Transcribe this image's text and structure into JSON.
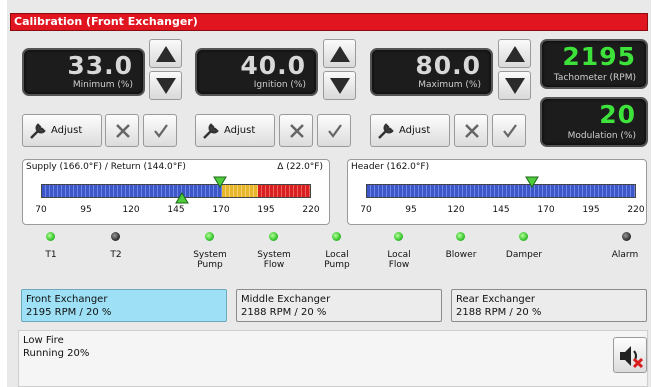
{
  "title": "Calibration (Front Exchanger)",
  "readouts": {
    "minimum": {
      "value": "33.0",
      "label": "Minimum (%)"
    },
    "ignition": {
      "value": "40.0",
      "label": "Ignition (%)"
    },
    "maximum": {
      "value": "80.0",
      "label": "Maximum (%)"
    },
    "tachometer": {
      "value": "2195",
      "label": "Tachometer (RPM)"
    },
    "modulation": {
      "value": "20",
      "label": "Modulation (%)"
    }
  },
  "adjust_label": "Adjust",
  "gauges": {
    "supply": {
      "title": "Supply (166.0°F) / Return (144.0°F)",
      "delta": "Δ (22.0°F)",
      "ticks": [
        "70",
        "95",
        "120",
        "145",
        "170",
        "195",
        "220"
      ],
      "supply_value": 166.0,
      "return_value": 144.0,
      "range": [
        70,
        220
      ],
      "colors": {
        "normal": "#3b57c9",
        "caution": "#e8b62a",
        "alarm": "#d92020"
      }
    },
    "header": {
      "title": "Header (162.0°F)",
      "ticks": [
        "70",
        "95",
        "120",
        "145",
        "170",
        "195",
        "220"
      ],
      "value": 162.0,
      "range": [
        70,
        220
      ]
    }
  },
  "indicators": [
    {
      "label": "T1",
      "state": "on"
    },
    {
      "label": "T2",
      "state": "off"
    },
    {
      "label": "System Pump",
      "state": "on"
    },
    {
      "label": "System Flow",
      "state": "on"
    },
    {
      "label": "Local Pump",
      "state": "on"
    },
    {
      "label": "Local Flow",
      "state": "on"
    },
    {
      "label": "Blower",
      "state": "on"
    },
    {
      "label": "Damper",
      "state": "on"
    },
    {
      "label": "Alarm",
      "state": "off"
    }
  ],
  "exchangers": [
    {
      "name": "Front Exchanger",
      "status": "2195 RPM / 20 %"
    },
    {
      "name": "Middle Exchanger",
      "status": "2188 RPM / 20 %"
    },
    {
      "name": "Rear Exchanger",
      "status": "2188 RPM / 20 %"
    }
  ],
  "status": {
    "line1": "Low Fire",
    "line2": "Running 20%"
  }
}
